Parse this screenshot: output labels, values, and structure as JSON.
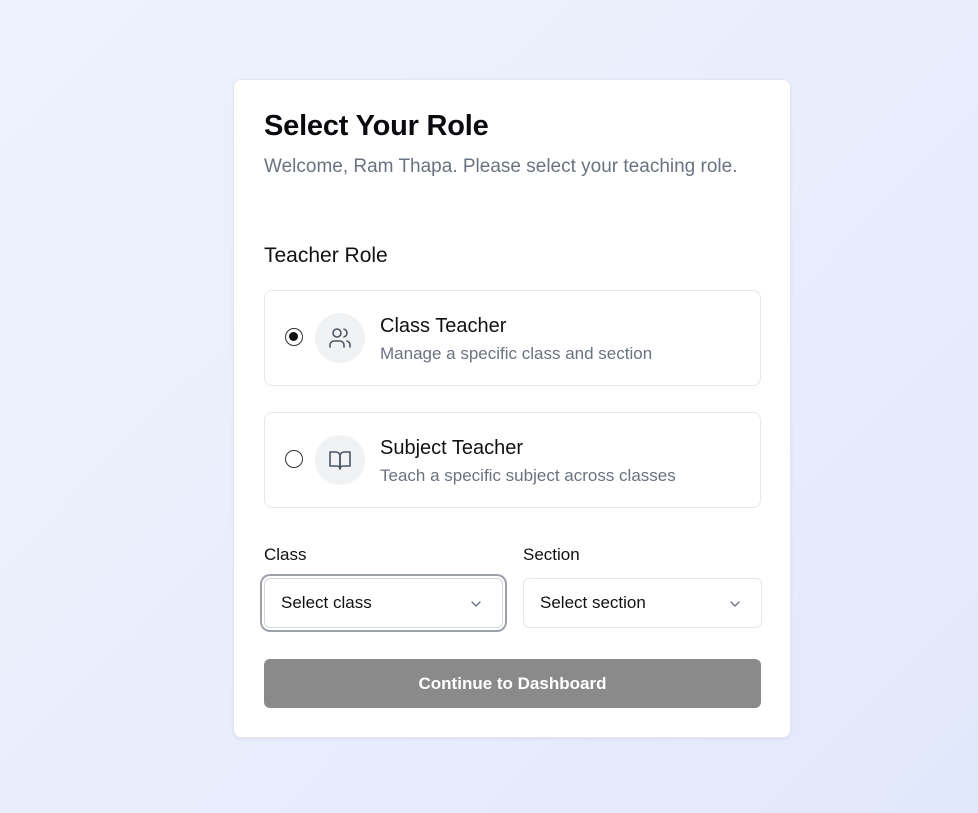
{
  "header": {
    "title": "Select Your Role",
    "subtitle": "Welcome, Ram Thapa. Please select your teaching role."
  },
  "role_section": {
    "label": "Teacher Role",
    "options": [
      {
        "title": "Class Teacher",
        "description": "Manage a specific class and section",
        "icon": "users-icon",
        "selected": true
      },
      {
        "title": "Subject Teacher",
        "description": "Teach a specific subject across classes",
        "icon": "book-open-icon",
        "selected": false
      }
    ]
  },
  "form": {
    "class": {
      "label": "Class",
      "placeholder": "Select class"
    },
    "section": {
      "label": "Section",
      "placeholder": "Select section"
    }
  },
  "actions": {
    "continue_label": "Continue to Dashboard",
    "continue_color": "#8a8a8a"
  },
  "colors": {
    "muted_text": "#6b7280",
    "card_border": "#e3e6ee"
  }
}
